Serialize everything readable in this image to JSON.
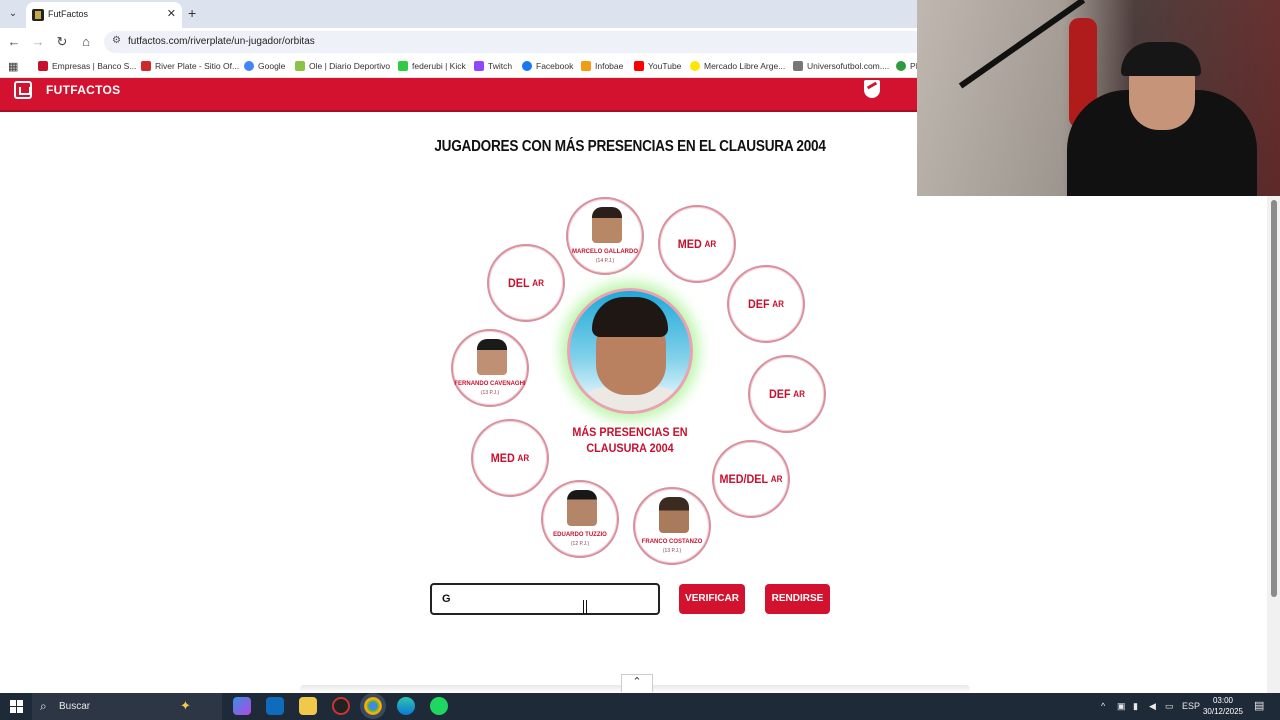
{
  "browser": {
    "tab_title": "FutFactos",
    "url": "futfactos.com/riverplate/un-jugador/orbitas",
    "bookmarks": [
      {
        "label": "Empresas | Banco S...",
        "color": "#c8102e"
      },
      {
        "label": "River Plate - Sitio Of...",
        "color": "#cf2a2a"
      },
      {
        "label": "Google",
        "color": "#4285f4"
      },
      {
        "label": "Ole | Diario Deportivo",
        "color": "#8bc34a"
      },
      {
        "label": "federubi | Kick",
        "color": "#2ecc40"
      },
      {
        "label": "Twitch",
        "color": "#9146ff"
      },
      {
        "label": "Facebook",
        "color": "#1877f2"
      },
      {
        "label": "Infobae",
        "color": "#f39c12"
      },
      {
        "label": "YouTube",
        "color": "#ff0000"
      },
      {
        "label": "Mercado Libre Arge...",
        "color": "#ffe600"
      },
      {
        "label": "Universofutbol.com....",
        "color": "#777777"
      },
      {
        "label": "PI",
        "color": "#2e9b3e"
      }
    ]
  },
  "site": {
    "brand": "FUTFACTOS",
    "accent": "#d3122f"
  },
  "game": {
    "title": "JUGADORES CON MÁS PRESENCIAS EN EL CLAUSURA 2004",
    "center_label": "MÁS PRESENCIAS EN CLAUSURA 2004",
    "orbs": [
      {
        "type": "player",
        "name": "MARCELO GALLARDO",
        "pj": "(14 P.J.)"
      },
      {
        "type": "slot",
        "pos": "MED",
        "country": "AR"
      },
      {
        "type": "slot",
        "pos": "DEF",
        "country": "AR"
      },
      {
        "type": "slot",
        "pos": "DEF",
        "country": "AR"
      },
      {
        "type": "slot",
        "pos": "MED/DEL",
        "country": "AR"
      },
      {
        "type": "player",
        "name": "FRANCO COSTANZO",
        "pj": "(13 P.J.)"
      },
      {
        "type": "player",
        "name": "EDUARDO TUZZIO",
        "pj": "(12 P.J.)"
      },
      {
        "type": "slot",
        "pos": "MED",
        "country": "AR"
      },
      {
        "type": "player",
        "name": "FERNANDO CAVENAGHI",
        "pj": "(13 P.J.)"
      },
      {
        "type": "slot",
        "pos": "DEL",
        "country": "AR"
      }
    ],
    "answer_value": "G",
    "verify_label": "VERIFICAR",
    "surrender_label": "RENDIRSE"
  },
  "taskbar": {
    "search_label": "Buscar",
    "language": "ESP",
    "time": "03:00",
    "date": "30/12/2025"
  }
}
